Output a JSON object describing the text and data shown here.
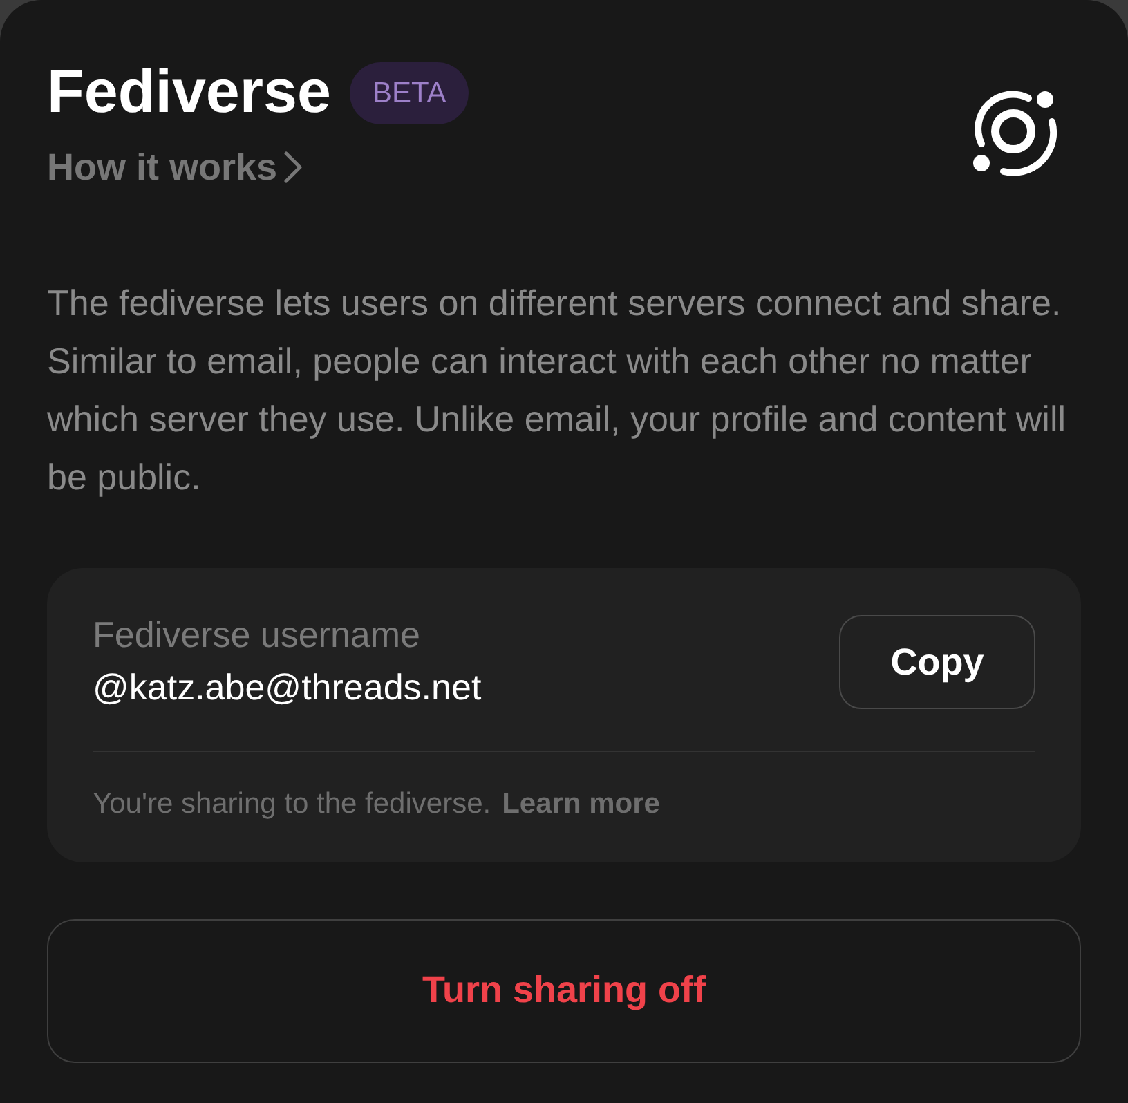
{
  "header": {
    "title": "Fediverse",
    "badge": "BETA",
    "link": "How it works"
  },
  "description": "The fediverse lets users on different servers connect and share. Similar to email, people can interact with each other no matter which server they use. Unlike email, your profile and content will be public.",
  "username_card": {
    "label": "Fediverse username",
    "value": "@katz.abe@threads.net",
    "copy_button": "Copy",
    "note": "You're sharing to the fediverse.",
    "note_link": "Learn more"
  },
  "action_button": "Turn sharing off"
}
